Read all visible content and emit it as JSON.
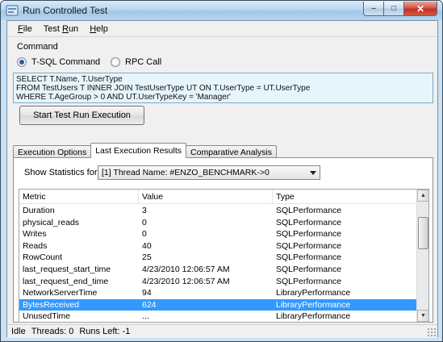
{
  "window": {
    "title": "Run Controlled Test",
    "buttons": {
      "minimize": "–",
      "maximize": "□",
      "close": "✕"
    }
  },
  "menu": [
    {
      "label": "File",
      "accel": "F"
    },
    {
      "label": "Test Run",
      "accel": "R"
    },
    {
      "label": "Help",
      "accel": "H"
    }
  ],
  "command": {
    "group_label": "Command",
    "options": [
      {
        "label": "T-SQL Command",
        "selected": true
      },
      {
        "label": "RPC Call",
        "selected": false
      }
    ],
    "sql_text": "SELECT T.Name, T.UserType\nFROM TestUsers T INNER JOIN TestUserType UT ON T.UserType = UT.UserType\nWHERE T.AgeGroup > 0 AND UT.UserTypeKey = 'Manager'",
    "run_button": "Start Test Run Execution"
  },
  "tabs": [
    {
      "label": "Execution Options",
      "active": false
    },
    {
      "label": "Last Execution Results",
      "active": true
    },
    {
      "label": "Comparative Analysis",
      "active": false
    }
  ],
  "results": {
    "stats_label": "Show Statistics for:",
    "stats_selected": "[1] Thread Name: #ENZO_BENCHMARK->0",
    "columns": [
      "Metric",
      "Value",
      "Type"
    ],
    "rows": [
      {
        "metric": "Duration",
        "value": "3",
        "type": "SQLPerformance",
        "selected": false
      },
      {
        "metric": "physical_reads",
        "value": "0",
        "type": "SQLPerformance",
        "selected": false
      },
      {
        "metric": "Writes",
        "value": "0",
        "type": "SQLPerformance",
        "selected": false
      },
      {
        "metric": "Reads",
        "value": "40",
        "type": "SQLPerformance",
        "selected": false
      },
      {
        "metric": "RowCount",
        "value": "25",
        "type": "SQLPerformance",
        "selected": false
      },
      {
        "metric": "last_request_start_time",
        "value": "4/23/2010 12:06:57 AM",
        "type": "SQLPerformance",
        "selected": false
      },
      {
        "metric": "last_request_end_time",
        "value": "4/23/2010 12:06:57 AM",
        "type": "SQLPerformance",
        "selected": false
      },
      {
        "metric": "NetworkServerTime",
        "value": "94",
        "type": "LibraryPerformance",
        "selected": false
      },
      {
        "metric": "BytesReceived",
        "value": "624",
        "type": "LibraryPerformance",
        "selected": true
      },
      {
        "metric": "UnusedTime",
        "value": "...",
        "type": "LibraryPerformance",
        "selected": false
      }
    ]
  },
  "status": {
    "state": "Idle",
    "threads": "Threads: 0",
    "runs_left": "Runs Left: -1"
  },
  "colors": {
    "selection": "#3399ff",
    "sql_background": "#e6f5fc"
  }
}
